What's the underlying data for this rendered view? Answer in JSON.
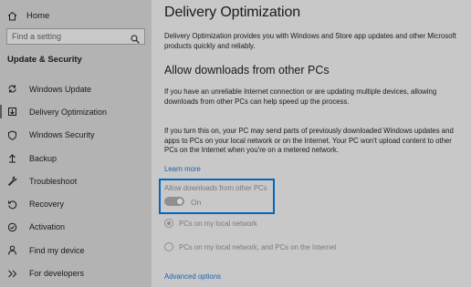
{
  "sidebar": {
    "home_label": "Home",
    "search_placeholder": "Find a setting",
    "section_title": "Update & Security",
    "items": [
      {
        "label": "Windows Update",
        "icon": "sync-icon"
      },
      {
        "label": "Delivery Optimization",
        "icon": "delivery-icon",
        "selected": true
      },
      {
        "label": "Windows Security",
        "icon": "shield-icon"
      },
      {
        "label": "Backup",
        "icon": "backup-icon"
      },
      {
        "label": "Troubleshoot",
        "icon": "wrench-icon"
      },
      {
        "label": "Recovery",
        "icon": "recovery-icon"
      },
      {
        "label": "Activation",
        "icon": "activation-icon"
      },
      {
        "label": "Find my device",
        "icon": "person-icon"
      },
      {
        "label": "For developers",
        "icon": "developer-icon"
      }
    ]
  },
  "main": {
    "title": "Delivery Optimization",
    "intro": "Delivery Optimization provides you with Windows and Store app updates and other Microsoft products quickly and reliably.",
    "subheading": "Allow downloads from other PCs",
    "para1": "If you have an unreliable Internet connection or are updating multiple devices, allowing downloads from other PCs can help speed up the process.",
    "para2": "If you turn this on, your PC may send parts of previously downloaded Windows updates and apps to PCs on your local network or on the Internet. Your PC won't upload content to other PCs on the Internet when you're on a metered network.",
    "learn_more": "Learn more",
    "toggle_label": "Allow downloads from other PCs",
    "toggle_state": "On",
    "radio_local": "PCs on my local network",
    "radio_internet": "PCs on my local network, and PCs on the Internet",
    "advanced_options": "Advanced options"
  },
  "colors": {
    "accent": "#0067c0",
    "link": "#1f63a8"
  }
}
